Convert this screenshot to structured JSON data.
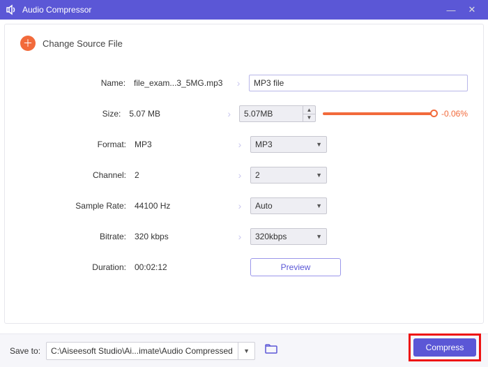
{
  "titlebar": {
    "title": "Audio Compressor"
  },
  "source": {
    "change_label": "Change Source File"
  },
  "labels": {
    "name": "Name:",
    "size": "Size:",
    "format": "Format:",
    "channel": "Channel:",
    "sample_rate": "Sample Rate:",
    "bitrate": "Bitrate:",
    "duration": "Duration:"
  },
  "values": {
    "name": "file_exam...3_5MG.mp3",
    "size": "5.07 MB",
    "format": "MP3",
    "channel": "2",
    "sample_rate": "44100 Hz",
    "bitrate": "320 kbps",
    "duration": "00:02:12"
  },
  "controls": {
    "name_input": "MP3 file",
    "size_spinner": "5.07MB",
    "size_slider_pct": "-0.06%",
    "format_select": "MP3",
    "channel_select": "2",
    "sample_rate_select": "Auto",
    "bitrate_select": "320kbps",
    "preview_btn": "Preview"
  },
  "footer": {
    "save_label": "Save to:",
    "path": "C:\\Aiseesoft Studio\\Ai...imate\\Audio Compressed",
    "compress_btn": "Compress"
  }
}
